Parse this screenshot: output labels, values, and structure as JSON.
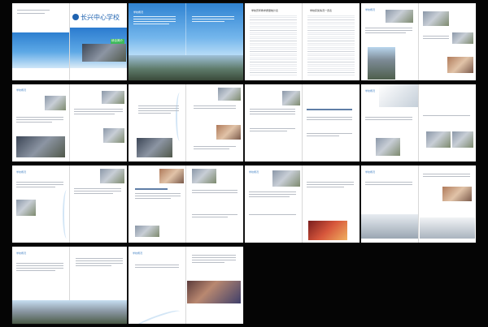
{
  "brochure": {
    "cover_title": "长兴中心学校",
    "cover_subtitle": "综合简介",
    "section_tag": "学校概况",
    "table_title_1": "学校历年教学质量统计表",
    "table_title_2": "学校获奖情况一览表"
  },
  "colors": {
    "background": "#050505",
    "accent_blue": "#2f83d2",
    "text_gray": "#b9bec6"
  }
}
